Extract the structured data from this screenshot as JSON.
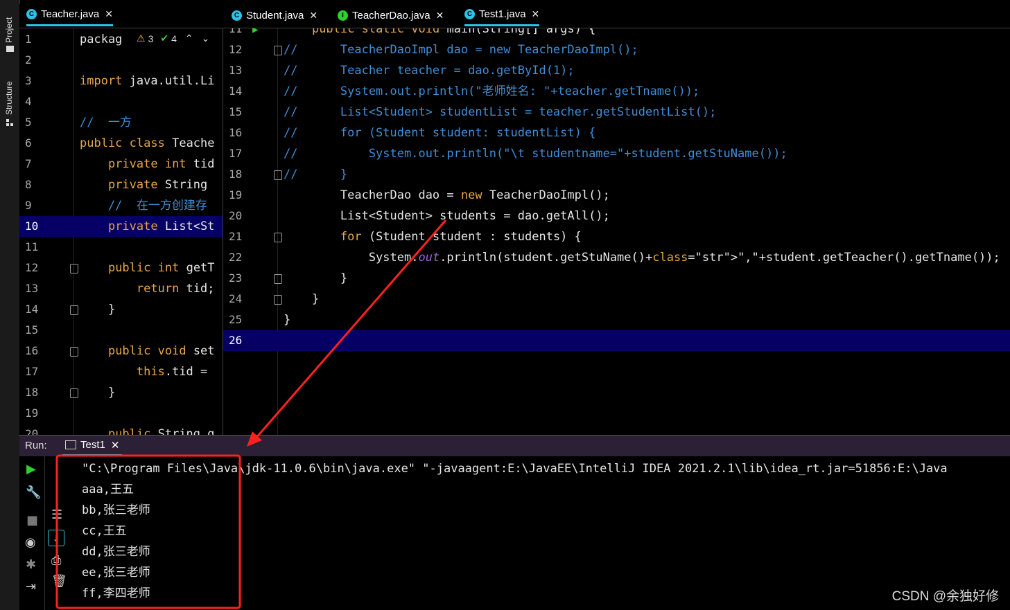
{
  "left_strip": {
    "project_label": "Project",
    "structure_label": "Structure"
  },
  "left_editor": {
    "tab": {
      "label": "Teacher.java",
      "close": "✕"
    },
    "inspection": {
      "warnings": "3",
      "checks": "4"
    },
    "lines": [
      {
        "n": "1",
        "code": "packag"
      },
      {
        "n": "2",
        "code": ""
      },
      {
        "n": "3",
        "code": "import java.util.Li"
      },
      {
        "n": "4",
        "code": ""
      },
      {
        "n": "5",
        "code": "//  一方"
      },
      {
        "n": "6",
        "code": "public class Teache"
      },
      {
        "n": "7",
        "code": "    private int tid"
      },
      {
        "n": "8",
        "code": "    private String"
      },
      {
        "n": "9",
        "code": "    //  在一方创建存"
      },
      {
        "n": "10",
        "code": "    private List<St"
      },
      {
        "n": "11",
        "code": ""
      },
      {
        "n": "12",
        "code": "    public int getT"
      },
      {
        "n": "13",
        "code": "        return tid;"
      },
      {
        "n": "14",
        "code": "    }"
      },
      {
        "n": "15",
        "code": ""
      },
      {
        "n": "16",
        "code": "    public void set"
      },
      {
        "n": "17",
        "code": "        this.tid ="
      },
      {
        "n": "18",
        "code": "    }"
      },
      {
        "n": "19",
        "code": ""
      },
      {
        "n": "20",
        "code": "    public String g"
      }
    ]
  },
  "right_editor": {
    "tabs": [
      {
        "label": "Student.java",
        "icon": "class-icon",
        "close": "✕"
      },
      {
        "label": "TeacherDao.java",
        "icon": "interface-icon",
        "close": "✕"
      },
      {
        "label": "Test1.java",
        "icon": "class-icon",
        "close": "✕"
      }
    ],
    "lines": [
      {
        "n": "11",
        "code": "    public static void main(String[] args) {"
      },
      {
        "n": "12",
        "code": "//      TeacherDaoImpl dao = new TeacherDaoImpl();"
      },
      {
        "n": "13",
        "code": "//      Teacher teacher = dao.getById(1);"
      },
      {
        "n": "14",
        "code": "//      System.out.println(\"老师姓名: \"+teacher.getTname());"
      },
      {
        "n": "15",
        "code": "//      List<Student> studentList = teacher.getStudentList();"
      },
      {
        "n": "16",
        "code": "//      for (Student student: studentList) {"
      },
      {
        "n": "17",
        "code": "//          System.out.println(\"\\t studentname=\"+student.getStuName());"
      },
      {
        "n": "18",
        "code": "//      }"
      },
      {
        "n": "19",
        "code": "        TeacherDao dao = new TeacherDaoImpl();"
      },
      {
        "n": "20",
        "code": "        List<Student> students = dao.getAll();"
      },
      {
        "n": "21",
        "code": "        for (Student student : students) {"
      },
      {
        "n": "22",
        "code": "            System.out.println(student.getStuName()+\",\"+student.getTeacher().getTname());"
      },
      {
        "n": "23",
        "code": "        }"
      },
      {
        "n": "24",
        "code": "    }"
      },
      {
        "n": "25",
        "code": "}"
      },
      {
        "n": "26",
        "code": ""
      }
    ]
  },
  "run_panel": {
    "label": "Run:",
    "tab": "Test1",
    "close": "✕",
    "output": [
      "\"C:\\Program Files\\Java\\jdk-11.0.6\\bin\\java.exe\" \"-javaagent:E:\\JavaEE\\IntelliJ IDEA 2021.2.1\\lib\\idea_rt.jar=51856:E:\\Java",
      "aaa,王五",
      "bb,张三老师",
      "cc,王五",
      "dd,张三老师",
      "ee,张三老师",
      "ff,李四老师"
    ]
  },
  "watermark": "CSDN @余独好修",
  "colors": {
    "accent": "#2bc4e8",
    "highlight": "#060066",
    "annotation": "#ff2020",
    "keyword": "#e8a64a",
    "comment": "#3f8ed6"
  }
}
